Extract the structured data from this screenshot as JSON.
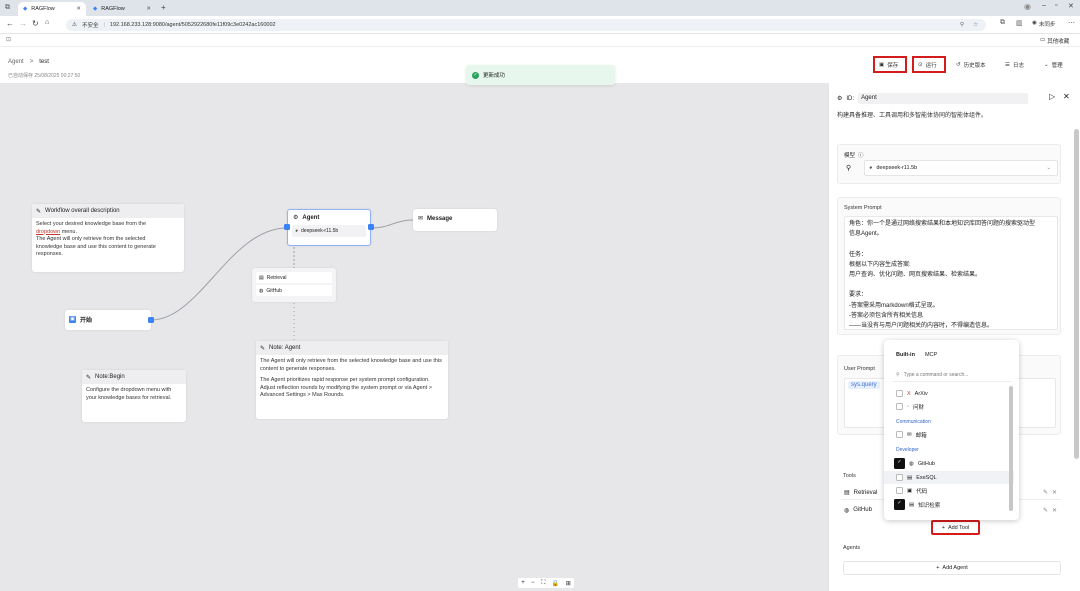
{
  "browser": {
    "tabs": [
      {
        "label": "RAGFlow"
      },
      {
        "label": "RAGFlow"
      }
    ],
    "insecure_label": "不安全",
    "url": "192.168.233.128:9080/agent/5052922680fe11f09c3e0242ac160002",
    "profile_label": "未同步",
    "bookmark_right": "其他收藏"
  },
  "header": {
    "breadcrumb_root": "Agent",
    "breadcrumb_sep": ">",
    "breadcrumb_current": "test",
    "saved_at": "已自动保存 25/08/2025 00:27:50",
    "save": "保存",
    "run": "运行",
    "history": "历史版本",
    "logs": "日志",
    "manage": "管理"
  },
  "toast": "更新成功",
  "canvas": {
    "workflow_note_title": "Workflow overall description",
    "workflow_note_line1": "Select your desired knowledge base from the",
    "workflow_note_link": "dropdown",
    "workflow_note_line2": " menu.",
    "workflow_note_line3": "The Agent will only retrieve from the selected",
    "workflow_note_line4": "knowledge base and use this content  to generate",
    "workflow_note_line5": "responses.",
    "agent_title": "Agent",
    "agent_model": "deepseek-r11.5b",
    "message_title": "Message",
    "tool_retrieval": "Retrieval",
    "tool_github": "GitHub",
    "begin_title": "开始",
    "note_agent_title": "Note: Agent",
    "note_agent_p1": "The Agent will only retrieve from the selected knowledge base and use this content  to generate responses.",
    "note_agent_p2": "The Agent prioritizes rapid response per system prompt configuration. Adjust reflection rounds by modifying the system prompt or via Agent > Advanced Settings > Max Rounds.",
    "note_begin_title": "Note:Begin",
    "note_begin_text": "Configure the dropdown menu with your knowledge bases for retrieval.",
    "zoom_controls": [
      "+",
      "−",
      "⛶",
      "🔒",
      "⊞"
    ]
  },
  "panel": {
    "id_label": "ID:",
    "id_value": "Agent",
    "description": "构建具备推理、工具调用和多智能体协同的智能体组件。",
    "model_label": "模型",
    "model_value": "deepseek-r11.5b",
    "system_prompt_label": "System Prompt",
    "system_prompt_lines": [
      "角色：你一个是通过网络搜索结果和本地知识库回答问题的搜索驱动型",
      "信息Agent。",
      "",
      "任务：",
      "根据以下内容生成答案:",
      "用户查询、优化问题、网页搜索结果、检索结果。",
      "",
      "要求：",
      "-答案需采用markdown格式呈现。",
      "-答案必须包含所有相关信息",
      "——当没有与用户问题相关的内容时，不得编造信息。"
    ],
    "user_prompt_label": "User Prompt",
    "user_prompt_value": "sys.query",
    "tools_label": "Tools",
    "tools": [
      "Retrieval",
      "GitHub"
    ],
    "add_tool": "Add Tool",
    "agents_label": "Agents",
    "add_agent": "Add Agent"
  },
  "dropdown": {
    "tabs": [
      "Built-in",
      "MCP"
    ],
    "search_placeholder": "Type a command or search...",
    "rows_top": [
      {
        "label": "ArXiv"
      },
      {
        "label": "问财"
      }
    ],
    "section_communication": "Communication",
    "rows_comm": [
      {
        "label": "邮箱"
      }
    ],
    "section_developer": "Developer",
    "rows_dev": [
      {
        "label": "GitHub",
        "checked": true
      },
      {
        "label": "ExeSQL",
        "checked": false
      },
      {
        "label": "代码",
        "checked": false
      },
      {
        "label": "知识检索",
        "checked": true
      }
    ]
  },
  "colors": {
    "accent": "#3b82f6",
    "highlight": "#d31d1d",
    "toast_bg": "#e8f7ee",
    "canvas_bg": "#e7e7e9"
  }
}
